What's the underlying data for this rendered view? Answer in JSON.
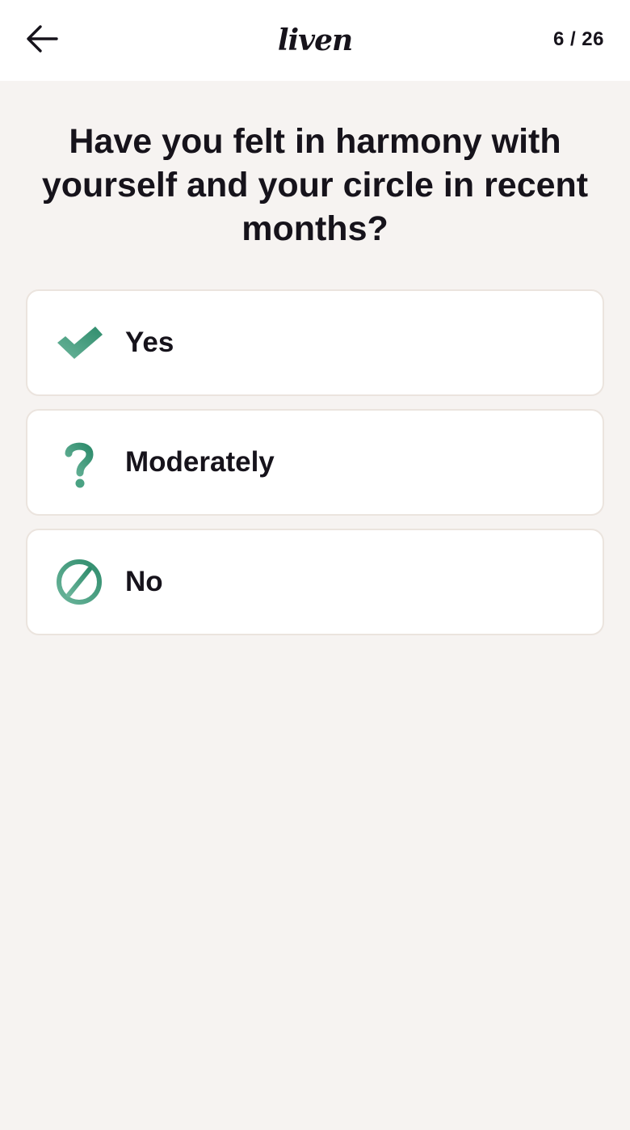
{
  "header": {
    "back_icon": "arrow-left-icon",
    "logo_text": "liven",
    "progress": "6 / 26"
  },
  "question": "Have you felt in harmony with yourself and your circle in recent months?",
  "options": [
    {
      "label": "Yes",
      "icon": "checkmark-icon"
    },
    {
      "label": "Moderately",
      "icon": "question-mark-icon"
    },
    {
      "label": "No",
      "icon": "prohibited-icon"
    }
  ],
  "colors": {
    "accent_green": "#3f9a7b",
    "background": "#f6f3f1",
    "card_border": "#ebe4de",
    "text": "#16131b"
  }
}
